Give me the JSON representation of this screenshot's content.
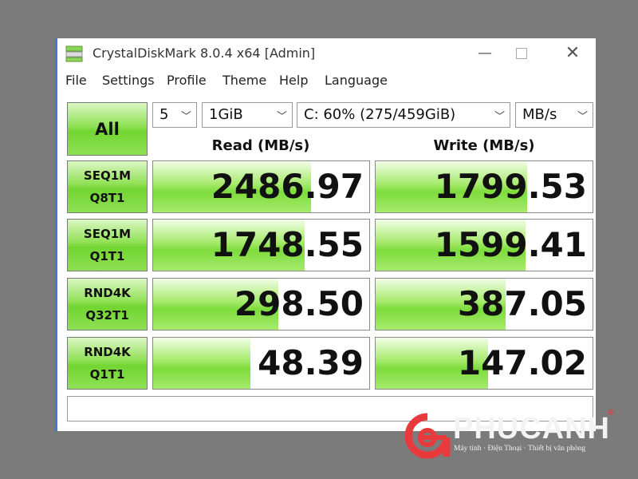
{
  "window": {
    "title": "CrystalDiskMark 8.0.4 x64 [Admin]",
    "controls": {
      "minimize": "—",
      "close": "✕"
    }
  },
  "menu": [
    "File",
    "Settings",
    "Profile",
    "Theme",
    "Help",
    "Language"
  ],
  "toolbar": {
    "all_button": "All",
    "count": "5",
    "size": "1GiB",
    "drive": "C: 60% (275/459GiB)",
    "unit": "MB/s"
  },
  "headers": {
    "read": "Read (MB/s)",
    "write": "Write (MB/s)"
  },
  "tests": [
    {
      "line1": "SEQ1M",
      "line2": "Q8T1",
      "read": "2486.97",
      "write": "1799.53",
      "read_fill": 0.73,
      "write_fill": 0.7
    },
    {
      "line1": "SEQ1M",
      "line2": "Q1T1",
      "read": "1748.55",
      "write": "1599.41",
      "read_fill": 0.7,
      "write_fill": 0.69
    },
    {
      "line1": "RND4K",
      "line2": "Q32T1",
      "read": "298.50",
      "write": "387.05",
      "read_fill": 0.58,
      "write_fill": 0.6
    },
    {
      "line1": "RND4K",
      "line2": "Q1T1",
      "read": "48.39",
      "write": "147.02",
      "read_fill": 0.45,
      "write_fill": 0.52
    }
  ],
  "comment": "",
  "watermark": {
    "brand": "PHUCANH",
    "registered": "®",
    "tagline": "Máy tính · Điện Thoại · Thiết bị văn phòng"
  },
  "colors": {
    "accent_green": "#7ddc3b",
    "window_border": "#3a7bd5",
    "logo_red": "#e8393d"
  }
}
